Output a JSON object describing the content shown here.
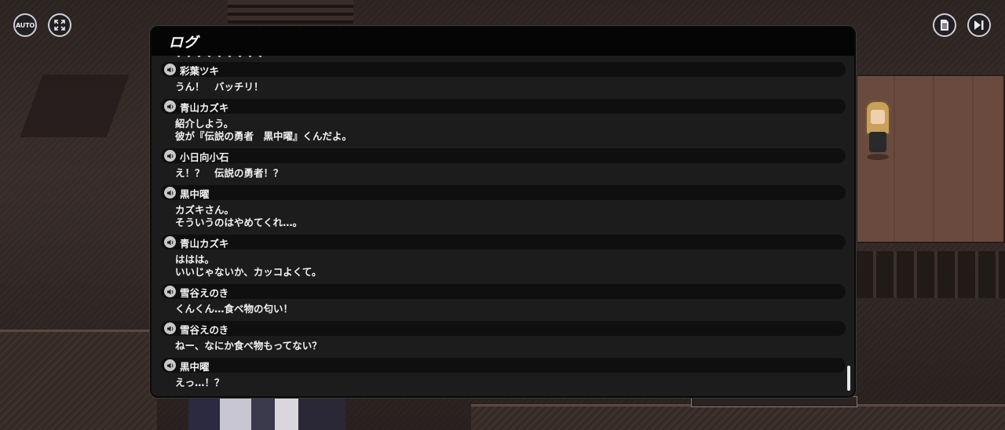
{
  "hud": {
    "auto_label": "AUTO",
    "fullscreen_icon": "fullscreen-icon",
    "log_icon": "log-icon",
    "skip_icon": "skip-icon"
  },
  "log": {
    "title": "ログ",
    "cut_off_line": "・・・・・・・・・",
    "entries": [
      {
        "speaker": "彩葉ツキ",
        "lines": [
          "うん！　バッチリ！"
        ]
      },
      {
        "speaker": "青山カズキ",
        "lines": [
          "紹介しよう。",
          "彼が『伝説の勇者　黒中曜』くんだよ。"
        ]
      },
      {
        "speaker": "小日向小石",
        "lines": [
          "え！？　伝説の勇者！？"
        ]
      },
      {
        "speaker": "黒中曜",
        "lines": [
          "カズキさん。",
          "そういうのはやめてくれ…。"
        ]
      },
      {
        "speaker": "青山カズキ",
        "lines": [
          "ははは。",
          "いいじゃないか、カッコよくて。"
        ]
      },
      {
        "speaker": "雪谷えのき",
        "lines": [
          "くんくん…食べ物の匂い！"
        ]
      },
      {
        "speaker": "雪谷えのき",
        "lines": [
          "ねー、なにか食べ物もってない？"
        ]
      },
      {
        "speaker": "黒中曜",
        "lines": [
          "えっ…！？"
        ]
      }
    ]
  },
  "colors": {
    "panel": "#1c1c1c",
    "header": "#050505",
    "name_bar": "#0f0f0f",
    "text": "#f0f0f0"
  }
}
